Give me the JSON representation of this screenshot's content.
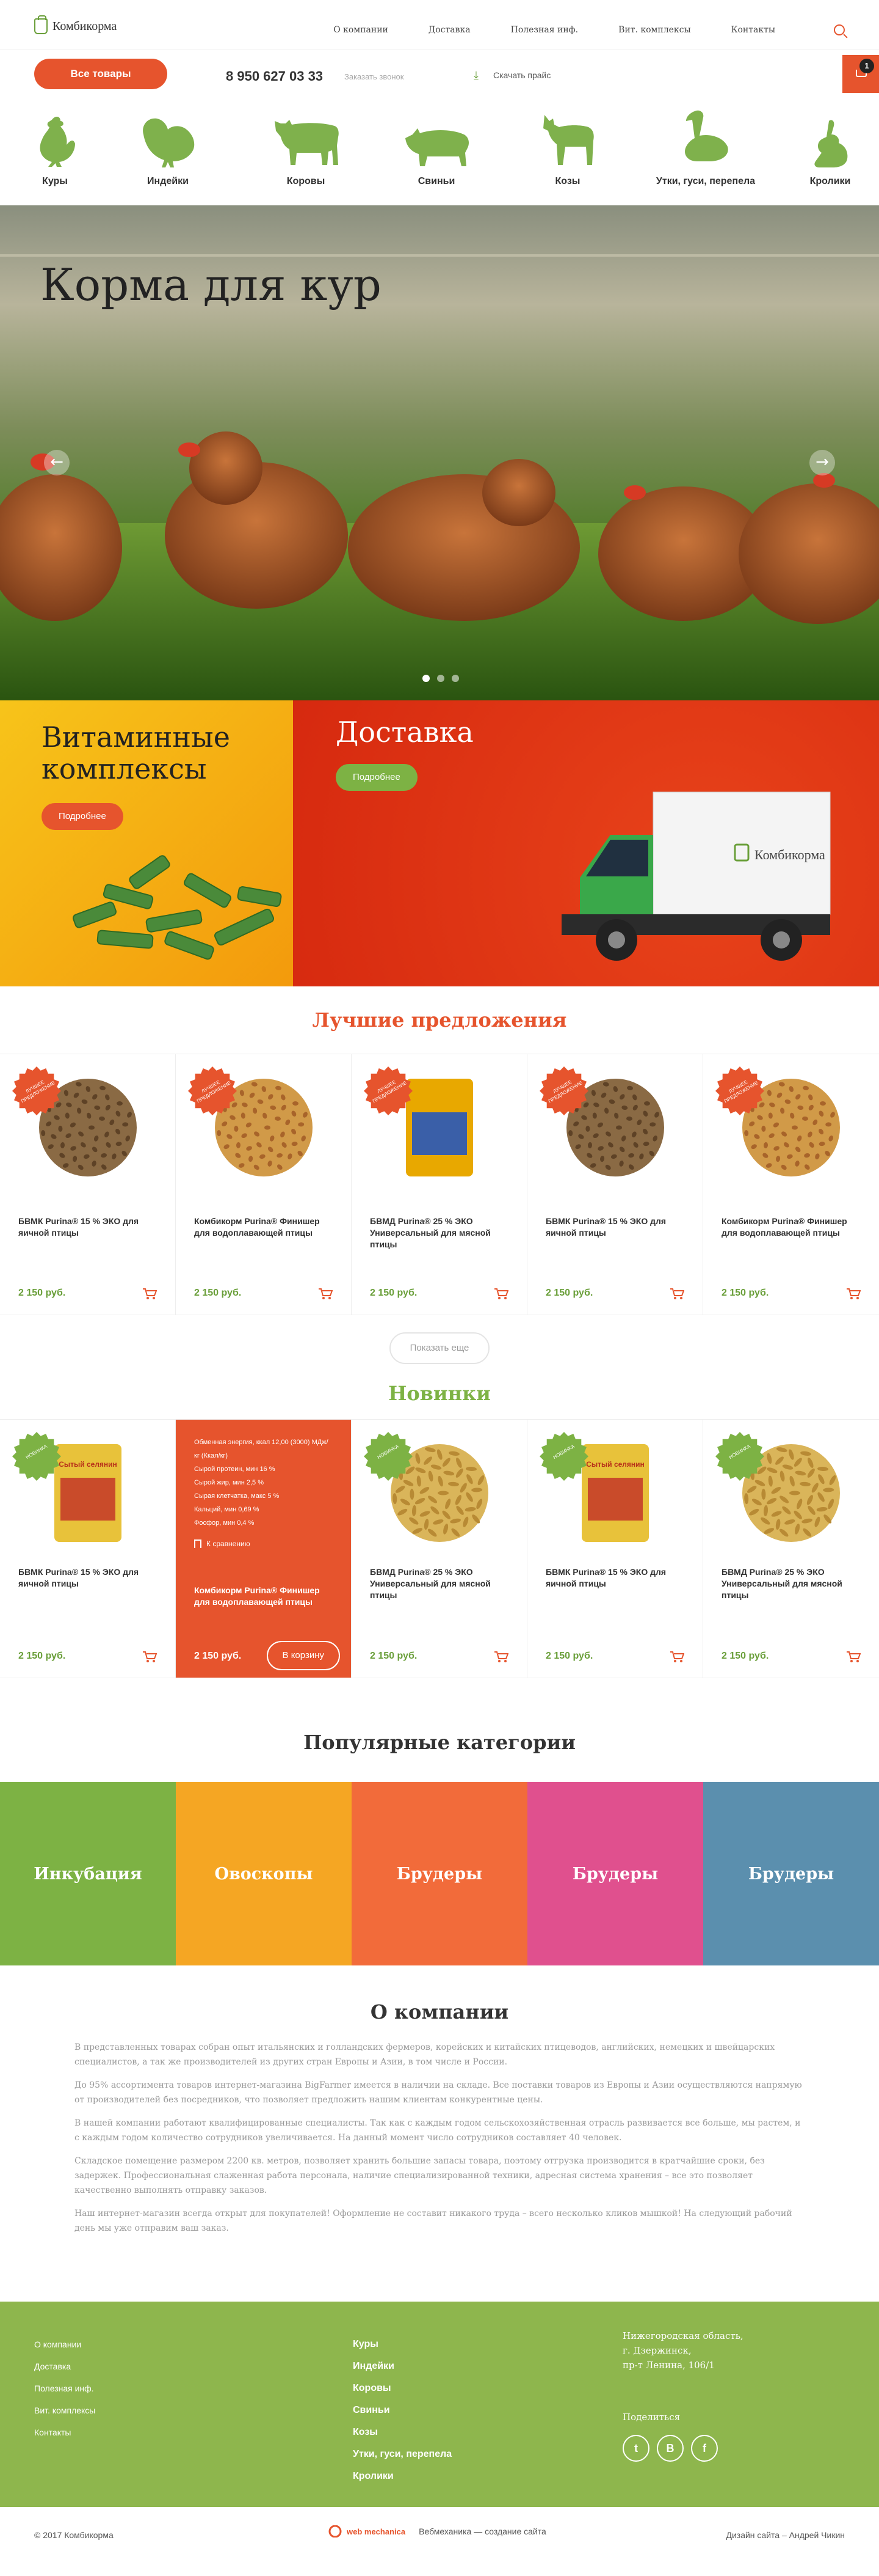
{
  "brand": {
    "name": "Комбикорма",
    "accent": "#e6542d",
    "green": "#6a9f3a"
  },
  "nav": [
    "О компании",
    "Доставка",
    "Полезная инф.",
    "Вит. комплексы",
    "Контакты"
  ],
  "header": {
    "all_goods": "Все товары",
    "phone": "8 950 627 03 33",
    "callback": "Заказать звонок",
    "download": "Скачать прайс",
    "cart_count": "1"
  },
  "animals": [
    "Куры",
    "Индейки",
    "Коровы",
    "Свиньи",
    "Козы",
    "Утки, гуси, перепела",
    "Кролики"
  ],
  "hero": {
    "title": "Корма для кур",
    "prev": "←",
    "next": "→"
  },
  "promo": {
    "vitamins": {
      "title": "Витаминные комплексы",
      "button": "Подробнее"
    },
    "delivery": {
      "title": "Доставка",
      "button": "Подробнее",
      "truck_label": "Комбикорма"
    }
  },
  "best": {
    "title": "Лучшие предложения",
    "badge": "лучшее предложение",
    "items": [
      {
        "name": "БВМК Purina® 15 % ЭКО для яичной птицы",
        "price": "2 150 руб."
      },
      {
        "name": "Комбикорм Purina® Финишер для водоплавающей птицы",
        "price": "2 150 руб."
      },
      {
        "name": "БВМД Purina® 25 % ЭКО Универсальный для мясной птицы",
        "price": "2 150 руб."
      },
      {
        "name": "БВМК Purina® 15 % ЭКО для яичной птицы",
        "price": "2 150 руб."
      },
      {
        "name": "Комбикорм Purina® Финишер для водоплавающей птицы",
        "price": "2 150 руб."
      }
    ],
    "show_more": "Показать еще"
  },
  "news": {
    "title": "Новинки",
    "badge": "новинка",
    "pack_label": "Сытый селянин",
    "items": [
      {
        "name": "БВМК Purina® 15 % ЭКО для яичной птицы",
        "price": "2 150 руб."
      },
      {
        "name": "Комбикорм Purina® Финишер для водоплавающей птицы",
        "price": "2 150 руб.",
        "specs": [
          "Обменная энергия, ккал 12,00 (3000) МДж/кг (Ккал/кг)",
          "Сырой протеин, мин 16 %",
          "Сырой жир, мин 2,5 %",
          "Сырая клетчатка, макс 5 %",
          "Кальций, мин 0,69 %",
          "Фосфор, мин 0,4 %"
        ],
        "compare": "К сравнению",
        "to_cart": "В корзину"
      },
      {
        "name": "БВМД Purina® 25 % ЭКО Универсальный для мясной птицы",
        "price": "2 150 руб."
      },
      {
        "name": "БВМК Purina® 15 % ЭКО для яичной птицы",
        "price": "2 150 руб."
      },
      {
        "name": "БВМД Purina® 25 % ЭКО Универсальный для мясной птицы",
        "price": "2 150 руб."
      }
    ]
  },
  "categories": {
    "title": "Популярные категории",
    "items": [
      {
        "label": "Инкубация",
        "color": "#7db244"
      },
      {
        "label": "Овоскопы",
        "color": "#f5a623"
      },
      {
        "label": "Брудеры",
        "color": "#f26b3a"
      },
      {
        "label": "Брудеры",
        "color": "#e0508e"
      },
      {
        "label": "Брудеры",
        "color": "#5b8fae"
      }
    ]
  },
  "about": {
    "title": "О компании",
    "paragraphs": [
      "В представленных товарах собран опыт итальянских и голландских фермеров, корейских и китайских птицеводов, английских, немецких и швейцарских специалистов, а так же производителей из других стран Европы и Азии, в том числе и России.",
      "До 95% ассортимента товаров интернет-магазина BigFarmer имеется в наличии на складе. Все поставки товаров из Европы и Азии осуществляются напрямую от производителей без посредников, что позволяет предложить нашим клиентам конкурентные цены.",
      "В нашей компании работают квалифицированные специалисты. Так как с каждым годом сельскохозяйственная отрасль развивается все больше, мы растем, и с каждым годом количество сотрудников увеличивается. На данный момент число сотрудников составляет 40 человек.",
      "Складское помещение размером 2200 кв. метров, позволяет хранить большие запасы товара, поэтому отгрузка производится в кратчайшие сроки, без задержек. Профессиональная слаженная работа персонала, наличие специализированной техники, адресная система хранения – все это позволяет качественно выполнять отправку заказов.",
      "Наш интернет-магазин всегда открыт для покупателей! Оформление не составит никакого труда – всего несколько кликов мышкой! На следующий рабочий день мы уже отправим ваш заказ."
    ]
  },
  "footer": {
    "links": [
      "О компании",
      "Доставка",
      "Полезная инф.",
      "Вит. комплексы",
      "Контакты"
    ],
    "animals": [
      "Куры",
      "Индейки",
      "Коровы",
      "Свиньи",
      "Козы",
      "Утки, гуси, перепела",
      "Кролики"
    ],
    "address": [
      "Нижегородская область,",
      "г. Дзержинск,",
      "пр-т Ленина, 106/1"
    ],
    "share": "Поделиться",
    "socials": [
      "t",
      "В",
      "f"
    ],
    "copyright": "© 2017 Комбикорма",
    "dev_logo": "web mechanica",
    "dev": "Вебмеханика — создание сайта",
    "design": "Дизайн сайта – Андрей Чикин"
  }
}
